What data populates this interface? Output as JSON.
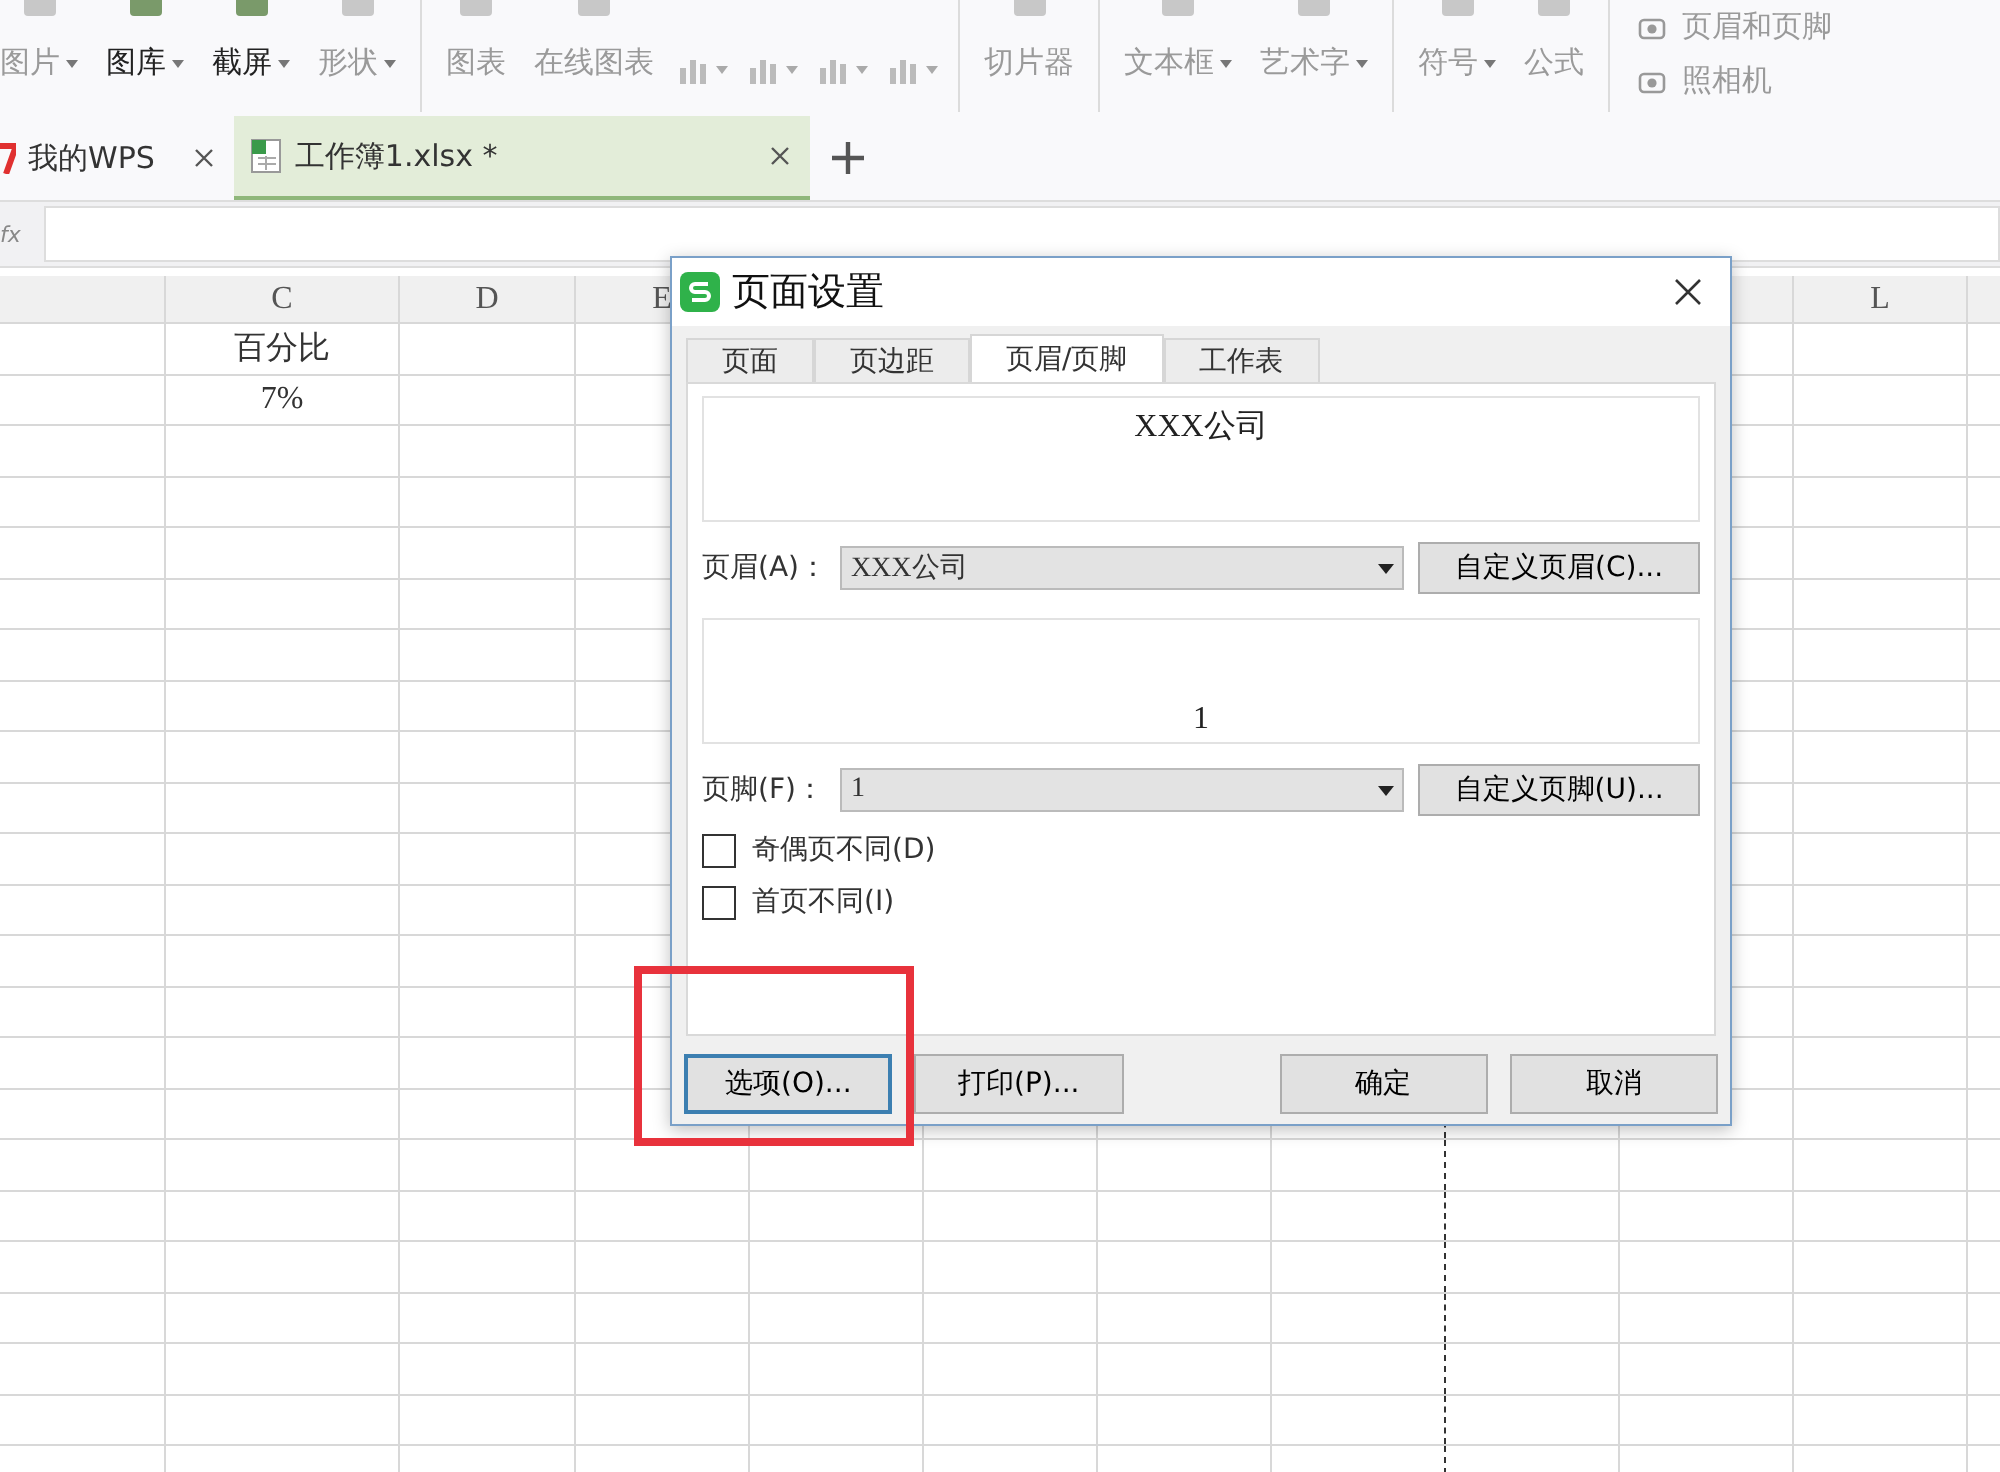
{
  "ribbon": {
    "groups": [
      {
        "items": [
          {
            "kind": "button",
            "label": "图片",
            "dropdown": true,
            "disabled": true
          },
          {
            "kind": "button",
            "label": "图库",
            "dropdown": true,
            "disabled": false
          },
          {
            "kind": "button",
            "label": "截屏",
            "dropdown": true,
            "disabled": false
          },
          {
            "kind": "button",
            "label": "形状",
            "dropdown": true,
            "disabled": true
          }
        ]
      },
      {
        "items": [
          {
            "kind": "button",
            "label": "图表",
            "dropdown": false,
            "disabled": true
          },
          {
            "kind": "button",
            "label": "在线图表",
            "dropdown": false,
            "disabled": true
          },
          {
            "kind": "icon",
            "dropdown": true,
            "disabled": true
          },
          {
            "kind": "icon",
            "dropdown": true,
            "disabled": true
          },
          {
            "kind": "icon",
            "dropdown": true,
            "disabled": true
          },
          {
            "kind": "icon",
            "dropdown": true,
            "disabled": true
          }
        ]
      },
      {
        "items": [
          {
            "kind": "button",
            "label": "切片器",
            "dropdown": false,
            "disabled": true
          }
        ]
      },
      {
        "items": [
          {
            "kind": "button",
            "label": "文本框",
            "dropdown": true,
            "disabled": true
          },
          {
            "kind": "button",
            "label": "艺术字",
            "dropdown": true,
            "disabled": true
          }
        ]
      },
      {
        "items": [
          {
            "kind": "button",
            "label": "符号",
            "dropdown": true,
            "disabled": true
          },
          {
            "kind": "button",
            "label": "公式",
            "dropdown": false,
            "disabled": true
          }
        ]
      },
      {
        "items": [
          {
            "kind": "small",
            "label": "页眉和页脚",
            "disabled": true
          },
          {
            "kind": "small",
            "label": "照相机",
            "disabled": true
          }
        ]
      }
    ]
  },
  "tabs": [
    {
      "label": "我的WPS",
      "logo": true,
      "selected": false
    },
    {
      "label": "工作簿1.xlsx *",
      "selected": true
    }
  ],
  "formula_bar": {
    "label": "fx"
  },
  "sheet": {
    "columns": [
      "C",
      "D",
      "E",
      "L"
    ],
    "rows": [
      {
        "cells": [
          "百分比"
        ]
      },
      {
        "cells": [
          "7%"
        ]
      }
    ]
  },
  "dialog": {
    "title": "页面设置",
    "tabs": [
      {
        "label": "页面",
        "selected": false
      },
      {
        "label": "页边距",
        "selected": false
      },
      {
        "label": "页眉/页脚",
        "selected": true
      },
      {
        "label": "工作表",
        "selected": false
      }
    ],
    "header_preview": "XXX公司",
    "header": {
      "label": "页眉(A)：",
      "value": "XXX公司",
      "button": "自定义页眉(C)..."
    },
    "footer_preview": "1",
    "footer": {
      "label": "页脚(F)：",
      "value": "1",
      "button": "自定义页脚(U)..."
    },
    "checkboxes": [
      {
        "label": "奇偶页不同(D)",
        "checked": false
      },
      {
        "label": "首页不同(I)",
        "checked": false
      }
    ],
    "buttons": [
      {
        "label": "选项(O)...",
        "focused": true
      },
      {
        "label": "打印(P)...",
        "focused": false
      },
      {
        "label": "确定",
        "focused": false
      },
      {
        "label": "取消",
        "focused": false
      }
    ]
  },
  "annotation": {
    "highlight": true
  }
}
